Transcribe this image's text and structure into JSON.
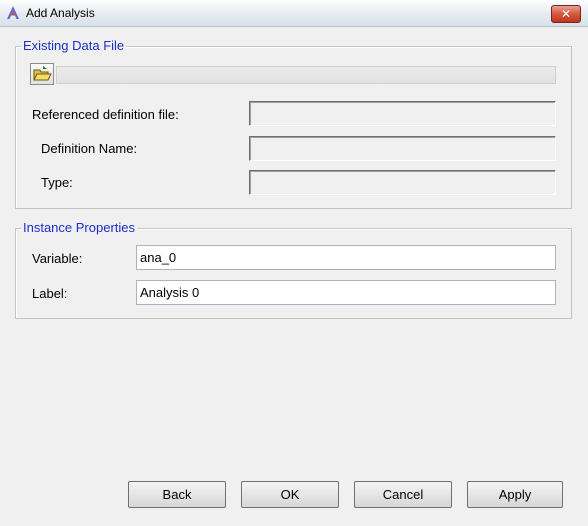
{
  "window": {
    "title": "Add Analysis",
    "close_glyph": "✕",
    "icon": "altair-app-icon"
  },
  "existing_data_file": {
    "legend": "Existing Data File",
    "open_icon": "folder-open-icon",
    "referenced_label": "Referenced definition file:",
    "referenced_value": "",
    "definition_name_label": "Definition Name:",
    "definition_name_value": "",
    "type_label": "Type:",
    "type_value": ""
  },
  "instance_properties": {
    "legend": "Instance Properties",
    "variable_label": "Variable:",
    "variable_value": "ana_0",
    "label_label": "Label:",
    "label_value": "Analysis 0"
  },
  "buttons": {
    "back": "Back",
    "ok": "OK",
    "cancel": "Cancel",
    "apply": "Apply"
  },
  "colors": {
    "legend_text": "#1d2fc8",
    "close_button": "#c1361c"
  }
}
